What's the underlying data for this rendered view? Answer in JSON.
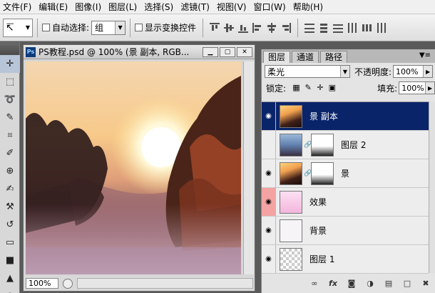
{
  "menu": [
    "文件(F)",
    "编辑(E)",
    "图像(I)",
    "图层(L)",
    "选择(S)",
    "滤镜(T)",
    "视图(V)",
    "窗口(W)",
    "帮助(H)"
  ],
  "options": {
    "auto_select_label": "自动选择:",
    "auto_select_value": "组",
    "show_transform_label": "显示变换控件"
  },
  "document": {
    "title": "PS教程.psd @ 100% (景 副本, RGB...",
    "zoom": "100%",
    "ps_badge": "Ps"
  },
  "panel": {
    "tabs": [
      "图层",
      "通道",
      "路径"
    ],
    "blend_mode": "柔光",
    "opacity_label": "不透明度:",
    "opacity_value": "100%",
    "lock_label": "锁定:",
    "fill_label": "填充:",
    "fill_value": "100%",
    "layers": [
      {
        "name": "景 副本",
        "visible": true,
        "selected": true,
        "thumb": "sunset",
        "mask": false
      },
      {
        "name": "图层 2",
        "visible": false,
        "selected": false,
        "thumb": "sky",
        "mask": true
      },
      {
        "name": "景",
        "visible": true,
        "selected": false,
        "thumb": "sunset",
        "mask": true
      },
      {
        "name": "效果",
        "visible": true,
        "selected": false,
        "thumb": "pink",
        "mask": false,
        "highlight": true
      },
      {
        "name": "背景",
        "visible": true,
        "selected": false,
        "thumb": "white",
        "mask": false
      },
      {
        "name": "图层 1",
        "visible": true,
        "selected": false,
        "thumb": "checker",
        "mask": false
      }
    ],
    "footer_icons": [
      "link-icon",
      "fx-icon",
      "mask-icon",
      "adjustment-icon",
      "group-icon",
      "new-layer-icon",
      "trash-icon"
    ]
  }
}
